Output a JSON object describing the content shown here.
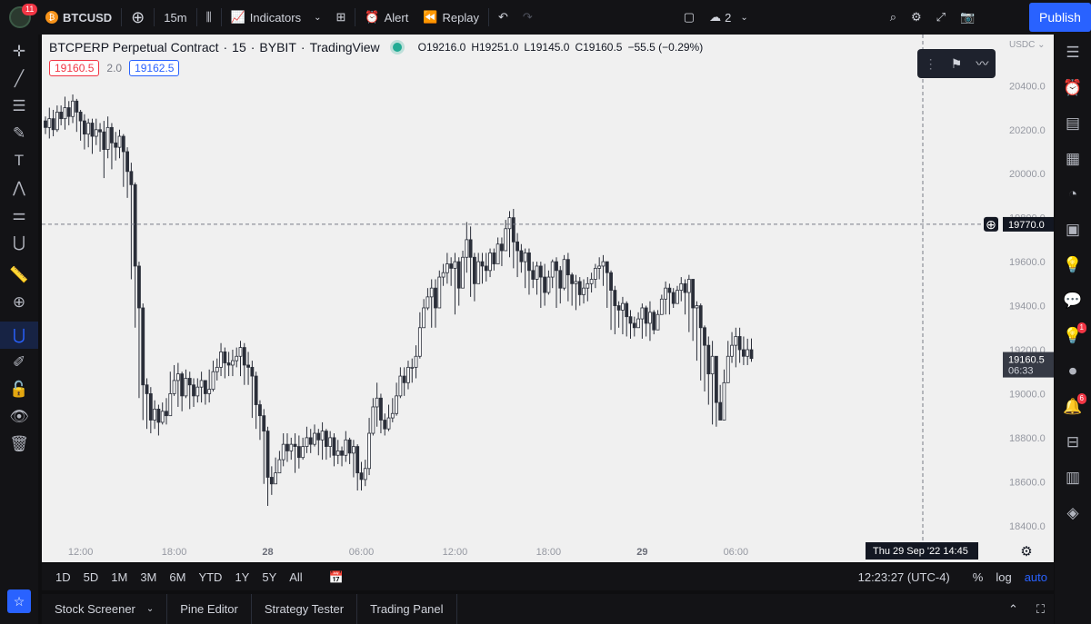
{
  "topbar": {
    "symbol": "BTCUSD",
    "notifications": "11",
    "interval": "15m",
    "indicators": "Indicators",
    "alert": "Alert",
    "replay": "Replay",
    "layouts": "2",
    "publish": "Publish"
  },
  "legend": {
    "title": "BTCPERP Perpetual Contract",
    "interval": "15",
    "exchange": "BYBIT",
    "source": "TradingView",
    "o": "O19216.0",
    "h": "H19251.0",
    "l": "L19145.0",
    "c": "C19160.5",
    "chg": "−55.5 (−0.29%)"
  },
  "prices": {
    "bid": "19160.5",
    "spread": "2.0",
    "ask": "19162.5"
  },
  "axis": {
    "currency": "USDC",
    "crosshair_price": "19770.0",
    "last_price": "19160.5",
    "countdown": "06:33",
    "crosshair_time": "Thu 29 Sep '22   14:45"
  },
  "bottombar": {
    "ranges": [
      "1D",
      "5D",
      "1M",
      "3M",
      "6M",
      "YTD",
      "1Y",
      "5Y",
      "All"
    ],
    "clock": "12:23:27 (UTC-4)",
    "pct": "%",
    "log": "log",
    "auto": "auto"
  },
  "panels": [
    "Stock Screener",
    "Pine Editor",
    "Strategy Tester",
    "Trading Panel"
  ],
  "right_badges": {
    "ideas": "1",
    "stream": "",
    "notify": "6"
  },
  "colors": {
    "candle": "#2a2e39",
    "panel": "#f0f0f0",
    "accent": "#2962ff",
    "sell": "#f23645"
  },
  "chart_data": {
    "type": "candlestick",
    "ylim": [
      18300,
      20550
    ],
    "yticks": [
      20400,
      20200,
      20000,
      19800,
      19600,
      19400,
      19200,
      19000,
      18800,
      18600,
      18400
    ],
    "xticks": [
      {
        "label": "12:00",
        "i": 9
      },
      {
        "label": "18:00",
        "i": 33
      },
      {
        "label": "28",
        "i": 57
      },
      {
        "label": "06:00",
        "i": 81
      },
      {
        "label": "12:00",
        "i": 105
      },
      {
        "label": "18:00",
        "i": 129
      },
      {
        "label": "29",
        "i": 153
      },
      {
        "label": "06:00",
        "i": 177
      }
    ],
    "close": [
      20210,
      20250,
      20200,
      20280,
      20250,
      20300,
      20260,
      20330,
      20280,
      20240,
      20180,
      20230,
      20170,
      20200,
      20190,
      20110,
      20210,
      20140,
      20120,
      20170,
      20100,
      20010,
      19950,
      19580,
      19390,
      19040,
      19000,
      18880,
      18930,
      18870,
      18920,
      18900,
      19000,
      19060,
      19090,
      18990,
      19070,
      19040,
      18990,
      19030,
      19060,
      19000,
      19020,
      19100,
      19120,
      19190,
      19140,
      19130,
      19150,
      19170,
      19210,
      19130,
      19120,
      19080,
      18950,
      18900,
      18830,
      18620,
      18590,
      18640,
      18700,
      18770,
      18740,
      18770,
      18760,
      18710,
      18760,
      18800,
      18770,
      18820,
      18790,
      18830,
      18760,
      18800,
      18720,
      18740,
      18720,
      18790,
      18730,
      18760,
      18640,
      18610,
      18660,
      18820,
      18940,
      18980,
      18880,
      18840,
      18890,
      18910,
      18990,
      19080,
      19050,
      19120,
      19120,
      19170,
      19300,
      19390,
      19440,
      19480,
      19390,
      19530,
      19550,
      19590,
      19570,
      19600,
      19480,
      19620,
      19700,
      19620,
      19500,
      19600,
      19580,
      19560,
      19640,
      19590,
      19680,
      19650,
      19750,
      19800,
      19690,
      19650,
      19600,
      19640,
      19560,
      19520,
      19580,
      19530,
      19460,
      19530,
      19600,
      19560,
      19480,
      19610,
      19540,
      19500,
      19510,
      19450,
      19480,
      19500,
      19520,
      19570,
      19580,
      19600,
      19550,
      19470,
      19400,
      19380,
      19410,
      19350,
      19320,
      19300,
      19340,
      19390,
      19320,
      19370,
      19290,
      19360,
      19430,
      19480,
      19460,
      19410,
      19470,
      19500,
      19460,
      19520,
      19390,
      19400,
      19300,
      19220,
      19090,
      19170,
      18960,
      18880,
      19050,
      19170,
      19220,
      19260,
      19200,
      19170,
      19200,
      19160
    ],
    "low": [
      20180,
      20160,
      20170,
      20190,
      20220,
      20200,
      20220,
      20230,
      20190,
      20150,
      20110,
      20120,
      20090,
      20130,
      20100,
      19980,
      20070,
      20020,
      20060,
      20070,
      19940,
      19890,
      19520,
      19300,
      18980,
      18880,
      18840,
      18820,
      18840,
      18810,
      18860,
      18860,
      18930,
      18990,
      18940,
      18920,
      18980,
      18930,
      18940,
      18960,
      18960,
      18950,
      18960,
      19010,
      19060,
      19080,
      19070,
      19080,
      19080,
      19120,
      19080,
      19040,
      19040,
      18890,
      18840,
      18790,
      18590,
      18490,
      18540,
      18600,
      18660,
      18670,
      18690,
      18700,
      18640,
      18660,
      18700,
      18730,
      18730,
      18760,
      18720,
      18700,
      18700,
      18710,
      18670,
      18680,
      18670,
      18690,
      18680,
      18620,
      18560,
      18560,
      18580,
      18630,
      18810,
      18850,
      18820,
      18810,
      18830,
      18870,
      18900,
      18980,
      18990,
      19020,
      19050,
      19070,
      19160,
      19330,
      19380,
      19300,
      19300,
      19440,
      19490,
      19500,
      19490,
      19360,
      19400,
      19530,
      19550,
      19440,
      19420,
      19510,
      19500,
      19510,
      19530,
      19560,
      19600,
      19580,
      19680,
      19620,
      19570,
      19530,
      19550,
      19480,
      19450,
      19480,
      19450,
      19390,
      19400,
      19450,
      19480,
      19390,
      19410,
      19470,
      19420,
      19400,
      19380,
      19400,
      19410,
      19420,
      19460,
      19480,
      19520,
      19490,
      19390,
      19290,
      19270,
      19300,
      19270,
      19260,
      19250,
      19260,
      19300,
      19250,
      19260,
      19240,
      19270,
      19330,
      19390,
      19360,
      19360,
      19390,
      19410,
      19420,
      19360,
      19280,
      19240,
      19150,
      19060,
      19010,
      18950,
      18860,
      18850,
      18880,
      19030,
      19130,
      19140,
      19120,
      19140,
      19130,
      19130,
      19145
    ],
    "high": [
      20260,
      20300,
      20290,
      20310,
      20310,
      20350,
      20330,
      20360,
      20340,
      20290,
      20270,
      20250,
      20250,
      20250,
      20230,
      20240,
      20260,
      20230,
      20190,
      20200,
      20180,
      20120,
      20050,
      19960,
      19600,
      19410,
      19070,
      19030,
      18970,
      18950,
      18960,
      18980,
      19100,
      19130,
      19140,
      19100,
      19110,
      19100,
      19070,
      19070,
      19100,
      19060,
      19110,
      19150,
      19160,
      19230,
      19210,
      19190,
      19200,
      19210,
      19240,
      19230,
      19190,
      19150,
      19100,
      18970,
      18930,
      18850,
      18670,
      18710,
      18740,
      18820,
      18820,
      18800,
      18820,
      18810,
      18800,
      18850,
      18840,
      18860,
      18840,
      18870,
      18840,
      18830,
      18820,
      18790,
      18760,
      18830,
      18800,
      18790,
      18770,
      18690,
      18700,
      18890,
      18980,
      19050,
      19000,
      18910,
      18950,
      18980,
      19050,
      19120,
      19120,
      19150,
      19160,
      19220,
      19370,
      19430,
      19480,
      19520,
      19520,
      19560,
      19590,
      19640,
      19620,
      19640,
      19620,
      19650,
      19780,
      19760,
      19640,
      19640,
      19640,
      19640,
      19660,
      19660,
      19710,
      19710,
      19790,
      19830,
      19840,
      19730,
      19680,
      19660,
      19660,
      19600,
      19600,
      19600,
      19590,
      19560,
      19610,
      19620,
      19580,
      19630,
      19640,
      19550,
      19540,
      19530,
      19520,
      19530,
      19550,
      19590,
      19620,
      19630,
      19600,
      19560,
      19490,
      19420,
      19440,
      19420,
      19380,
      19350,
      19370,
      19410,
      19400,
      19420,
      19380,
      19380,
      19450,
      19510,
      19500,
      19480,
      19490,
      19530,
      19520,
      19540,
      19500,
      19420,
      19410,
      19310,
      19260,
      19240,
      19170,
      19040,
      19110,
      19240,
      19280,
      19300,
      19300,
      19260,
      19250,
      19251
    ]
  }
}
